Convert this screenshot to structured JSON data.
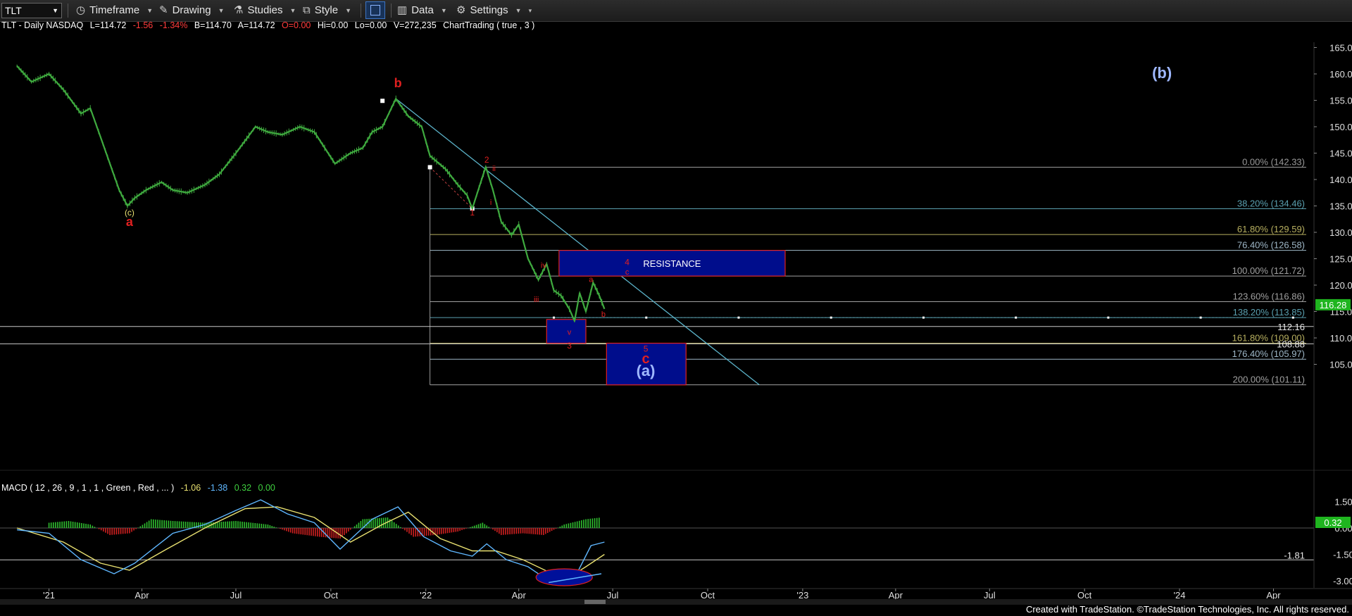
{
  "toolbar": {
    "symbol": "TLT",
    "timeframe": "Timeframe",
    "drawing": "Drawing",
    "studies": "Studies",
    "style": "Style",
    "data": "Data",
    "settings": "Settings"
  },
  "header": {
    "symbol": "TLT - Daily  NASDAQ",
    "last": "L=114.72",
    "change": "-1.56",
    "change_pct": "-1.34%",
    "bid": "B=114.70",
    "ask": "A=114.72",
    "open": "O=0.00",
    "high": "Hi=0.00",
    "low": "Lo=0.00",
    "volume": "V=272,235",
    "study": "ChartTrading ( true , 3 )"
  },
  "macd_header": {
    "label": "MACD ( 12 , 26 , 9 , 1 , 1 , Green , Red , ... )",
    "v1": "-1.06",
    "v2": "-1.38",
    "v3": "0.32",
    "v4": "0.00"
  },
  "footer": "Created with TradeStation. ©TradeStation Technologies, Inc. All rights reserved.",
  "colors": {
    "up": "#3faa3f",
    "fib_line": "#9a9a9a",
    "trend_line": "#5bb3c9",
    "box_fill": "#000d8c",
    "box_border": "#e02020",
    "wave_label": "#e02020",
    "macd_line": "#5fb7ff",
    "signal_line": "#e8e070"
  },
  "chart_data": {
    "type": "line",
    "title": "TLT - Daily  NASDAQ",
    "x_ticks": [
      "'21",
      "Apr",
      "Jul",
      "Oct",
      "'22",
      "Apr",
      "Jul",
      "Oct",
      "'23",
      "Apr",
      "Jul",
      "Oct",
      "'24",
      "Apr"
    ],
    "y_ticks": [
      "165.00",
      "160.00",
      "155.00",
      "150.00",
      "145.00",
      "140.00",
      "135.00",
      "130.00",
      "125.00",
      "120.00",
      "115.00",
      "110.00",
      "105.00"
    ],
    "ylim": [
      100,
      166
    ],
    "last_price_tag": "116.28",
    "price_series": {
      "name": "TLT",
      "points": [
        [
          "2020-12-01",
          161.5
        ],
        [
          "2020-12-15",
          158.5
        ],
        [
          "2021-01-01",
          160.0
        ],
        [
          "2021-01-15",
          157.0
        ],
        [
          "2021-02-01",
          152.5
        ],
        [
          "2021-02-10",
          153.5
        ],
        [
          "2021-02-20",
          148.0
        ],
        [
          "2021-03-01",
          143.0
        ],
        [
          "2021-03-10",
          138.0
        ],
        [
          "2021-03-18",
          135.0
        ],
        [
          "2021-03-25",
          136.5
        ],
        [
          "2021-04-05",
          138.0
        ],
        [
          "2021-04-20",
          139.5
        ],
        [
          "2021-05-01",
          138.0
        ],
        [
          "2021-05-15",
          137.5
        ],
        [
          "2021-06-01",
          139.0
        ],
        [
          "2021-06-15",
          141.0
        ],
        [
          "2021-07-01",
          145.0
        ],
        [
          "2021-07-20",
          150.0
        ],
        [
          "2021-08-01",
          149.0
        ],
        [
          "2021-08-15",
          148.5
        ],
        [
          "2021-09-01",
          150.0
        ],
        [
          "2021-09-15",
          149.0
        ],
        [
          "2021-09-25",
          146.0
        ],
        [
          "2021-10-05",
          143.0
        ],
        [
          "2021-10-20",
          145.0
        ],
        [
          "2021-11-01",
          146.0
        ],
        [
          "2021-11-10",
          149.0
        ],
        [
          "2021-11-20",
          150.0
        ],
        [
          "2021-12-03",
          155.3
        ],
        [
          "2021-12-15",
          152.0
        ],
        [
          "2021-12-28",
          150.0
        ],
        [
          "2022-01-05",
          144.5
        ],
        [
          "2022-01-20",
          142.0
        ],
        [
          "2022-02-01",
          139.0
        ],
        [
          "2022-02-10",
          137.0
        ],
        [
          "2022-02-15",
          134.5
        ],
        [
          "2022-02-28",
          142.4
        ],
        [
          "2022-03-07",
          138.0
        ],
        [
          "2022-03-15",
          132.0
        ],
        [
          "2022-03-25",
          129.5
        ],
        [
          "2022-04-01",
          131.5
        ],
        [
          "2022-04-10",
          125.0
        ],
        [
          "2022-04-20",
          121.0
        ],
        [
          "2022-04-28",
          124.0
        ],
        [
          "2022-05-05",
          119.0
        ],
        [
          "2022-05-12",
          118.0
        ],
        [
          "2022-05-20",
          115.5
        ],
        [
          "2022-05-25",
          113.2
        ],
        [
          "2022-05-30",
          118.5
        ],
        [
          "2022-06-05",
          115.0
        ],
        [
          "2022-06-12",
          120.5
        ],
        [
          "2022-06-18",
          118.0
        ],
        [
          "2022-06-23",
          115.5
        ]
      ]
    },
    "fib_levels": [
      {
        "pct": "0.00%",
        "price": 142.33,
        "label": "0.00% (142.33)",
        "color": "#9a9a9a"
      },
      {
        "pct": "38.20%",
        "price": 134.46,
        "label": "38.20% (134.46)",
        "color": "#5aa0b0"
      },
      {
        "pct": "61.80%",
        "price": 129.59,
        "label": "61.80% (129.59)",
        "color": "#b8b060"
      },
      {
        "pct": "76.40%",
        "price": 126.58,
        "label": "76.40% (126.58)",
        "color": "#9fb8c8"
      },
      {
        "pct": "100.00%",
        "price": 121.72,
        "label": "100.00% (121.72)",
        "color": "#a0a0a0"
      },
      {
        "pct": "123.60%",
        "price": 116.86,
        "label": "123.60% (116.86)",
        "color": "#a0a0a0"
      },
      {
        "pct": "138.20%",
        "price": 113.85,
        "label": "138.20% (113.85)",
        "color": "#5aa0b0"
      },
      {
        "pct": "161.80%",
        "price": 109.0,
        "label": "161.80% (109.00)",
        "color": "#b8b060"
      },
      {
        "pct": "176.40%",
        "price": 105.97,
        "label": "176.40% (105.97)",
        "color": "#9fb8c8"
      },
      {
        "pct": "200.00%",
        "price": 101.11,
        "label": "200.00% (101.11)",
        "color": "#a0a0a0"
      }
    ],
    "horizontal_lines": [
      {
        "price": 112.16,
        "label": "112.16",
        "color": "#c8c8c8"
      },
      {
        "price": 108.88,
        "label": "108.88",
        "color": "#c8c8c8"
      }
    ],
    "dotted_line": {
      "price": 113.85,
      "from": "2022-05-05",
      "to": "2024-04-20"
    },
    "trend_line": {
      "from": [
        "2021-12-03",
        155.3
      ],
      "to": [
        "2022-11-20",
        101.11
      ]
    },
    "fib_anchor": {
      "high": [
        "2022-01-05",
        142.33
      ],
      "low": [
        "2022-02-15",
        134.5
      ]
    },
    "boxes": [
      {
        "label": "RESISTANCE",
        "from": "2022-05-10",
        "to": "2022-12-15",
        "top": 126.58,
        "bottom": 121.72
      },
      {
        "label": "",
        "from": "2022-04-28",
        "to": "2022-06-05",
        "top": 113.5,
        "bottom": 109.0
      },
      {
        "label": "",
        "from": "2022-06-25",
        "to": "2022-09-10",
        "top": 109.0,
        "bottom": 101.11
      }
    ],
    "wave_labels": [
      {
        "text": "b",
        "date": "2021-12-05",
        "price": 157.5,
        "color": "#e02020",
        "size": 18
      },
      {
        "text": "(c)",
        "date": "2021-03-20",
        "price": 133.2,
        "color": "#e8e070",
        "size": 12
      },
      {
        "text": "a",
        "date": "2021-03-20",
        "price": 131.2,
        "color": "#e02020",
        "size": 18
      },
      {
        "text": "(b)",
        "date": "2023-12-15",
        "price": 159.2,
        "color": "#9fb8ff",
        "size": 22
      },
      {
        "text": "2",
        "date": "2022-03-01",
        "price": 143.2,
        "color": "#e02020",
        "size": 12
      },
      {
        "text": "ii",
        "date": "2022-03-08",
        "price": 141.6,
        "color": "#e02020",
        "size": 11
      },
      {
        "text": "i",
        "date": "2022-03-05",
        "price": 135.2,
        "color": "#e02020",
        "size": 11
      },
      {
        "text": "1",
        "date": "2022-02-15",
        "price": 133.2,
        "color": "#e02020",
        "size": 12
      },
      {
        "text": "4",
        "date": "2022-07-15",
        "price": 123.8,
        "color": "#e02020",
        "size": 12
      },
      {
        "text": "c",
        "date": "2022-07-15",
        "price": 122.0,
        "color": "#e02020",
        "size": 11
      },
      {
        "text": "iv",
        "date": "2022-04-25",
        "price": 123.3,
        "color": "#e02020",
        "size": 11
      },
      {
        "text": "a",
        "date": "2022-06-10",
        "price": 120.6,
        "color": "#e02020",
        "size": 11
      },
      {
        "text": "iii",
        "date": "2022-04-18",
        "price": 116.8,
        "color": "#e02020",
        "size": 11
      },
      {
        "text": "b",
        "date": "2022-06-22",
        "price": 114.0,
        "color": "#e02020",
        "size": 11
      },
      {
        "text": "v",
        "date": "2022-05-20",
        "price": 110.6,
        "color": "#e02020",
        "size": 11
      },
      {
        "text": "3",
        "date": "2022-05-20",
        "price": 108.0,
        "color": "#e02020",
        "size": 12
      },
      {
        "text": "5",
        "date": "2022-08-02",
        "price": 107.4,
        "color": "#e02020",
        "size": 12
      },
      {
        "text": "c",
        "date": "2022-08-02",
        "price": 105.2,
        "color": "#e02020",
        "size": 20
      },
      {
        "text": "(a)",
        "date": "2022-08-02",
        "price": 102.8,
        "color": "#9fb8ff",
        "size": 22
      }
    ],
    "macd": {
      "y_ticks": [
        "1.50",
        "0.00",
        "-1.50",
        "-3.00"
      ],
      "ylim": [
        -3.4,
        2.4
      ],
      "last_value_tag": "0.32",
      "level_line": {
        "value": -1.81,
        "label": "-1.81"
      },
      "macd_series": [
        [
          "2020-12-01",
          -0.1
        ],
        [
          "2021-01-01",
          -0.3
        ],
        [
          "2021-02-01",
          -1.8
        ],
        [
          "2021-03-05",
          -2.6
        ],
        [
          "2021-03-25",
          -2.0
        ],
        [
          "2021-05-01",
          -0.3
        ],
        [
          "2021-06-01",
          0.2
        ],
        [
          "2021-07-01",
          1.0
        ],
        [
          "2021-07-25",
          1.6
        ],
        [
          "2021-08-20",
          0.8
        ],
        [
          "2021-09-15",
          0.3
        ],
        [
          "2021-10-10",
          -1.2
        ],
        [
          "2021-11-10",
          0.5
        ],
        [
          "2021-12-05",
          1.2
        ],
        [
          "2021-12-30",
          -0.5
        ],
        [
          "2022-01-25",
          -1.3
        ],
        [
          "2022-02-15",
          -1.6
        ],
        [
          "2022-03-01",
          -0.9
        ],
        [
          "2022-03-20",
          -1.8
        ],
        [
          "2022-04-10",
          -2.2
        ],
        [
          "2022-04-30",
          -3.0
        ],
        [
          "2022-05-15",
          -2.9
        ],
        [
          "2022-05-28",
          -2.5
        ],
        [
          "2022-06-10",
          -1.0
        ],
        [
          "2022-06-23",
          -0.8
        ]
      ],
      "signal_series": [
        [
          "2020-12-01",
          0.0
        ],
        [
          "2021-01-15",
          -0.8
        ],
        [
          "2021-02-20",
          -2.0
        ],
        [
          "2021-03-20",
          -2.4
        ],
        [
          "2021-04-25",
          -1.2
        ],
        [
          "2021-06-01",
          0.0
        ],
        [
          "2021-07-10",
          1.1
        ],
        [
          "2021-08-10",
          1.2
        ],
        [
          "2021-09-15",
          0.6
        ],
        [
          "2021-10-20",
          -0.8
        ],
        [
          "2021-11-20",
          0.2
        ],
        [
          "2021-12-15",
          0.9
        ],
        [
          "2022-01-15",
          -0.6
        ],
        [
          "2022-02-15",
          -1.3
        ],
        [
          "2022-03-10",
          -1.3
        ],
        [
          "2022-04-05",
          -1.8
        ],
        [
          "2022-04-30",
          -2.5
        ],
        [
          "2022-05-20",
          -2.8
        ],
        [
          "2022-06-05",
          -2.2
        ],
        [
          "2022-06-23",
          -1.5
        ]
      ],
      "histogram": [
        [
          "2021-01-01",
          0.3
        ],
        [
          "2021-01-20",
          0.4
        ],
        [
          "2021-02-10",
          0.2
        ],
        [
          "2021-03-01",
          -0.4
        ],
        [
          "2021-03-20",
          -0.3
        ],
        [
          "2021-04-10",
          0.5
        ],
        [
          "2021-05-01",
          0.4
        ],
        [
          "2021-06-01",
          0.3
        ],
        [
          "2021-07-01",
          0.4
        ],
        [
          "2021-08-01",
          0.2
        ],
        [
          "2021-08-25",
          -0.3
        ],
        [
          "2021-09-20",
          -0.5
        ],
        [
          "2021-10-10",
          -0.6
        ],
        [
          "2021-11-01",
          0.5
        ],
        [
          "2021-11-25",
          0.6
        ],
        [
          "2021-12-20",
          -0.5
        ],
        [
          "2022-01-10",
          -0.4
        ],
        [
          "2022-02-01",
          -0.2
        ],
        [
          "2022-02-25",
          0.3
        ],
        [
          "2022-03-15",
          -0.4
        ],
        [
          "2022-04-05",
          -0.3
        ],
        [
          "2022-04-25",
          -0.4
        ],
        [
          "2022-05-15",
          0.2
        ],
        [
          "2022-06-05",
          0.5
        ],
        [
          "2022-06-20",
          0.6
        ]
      ]
    }
  }
}
